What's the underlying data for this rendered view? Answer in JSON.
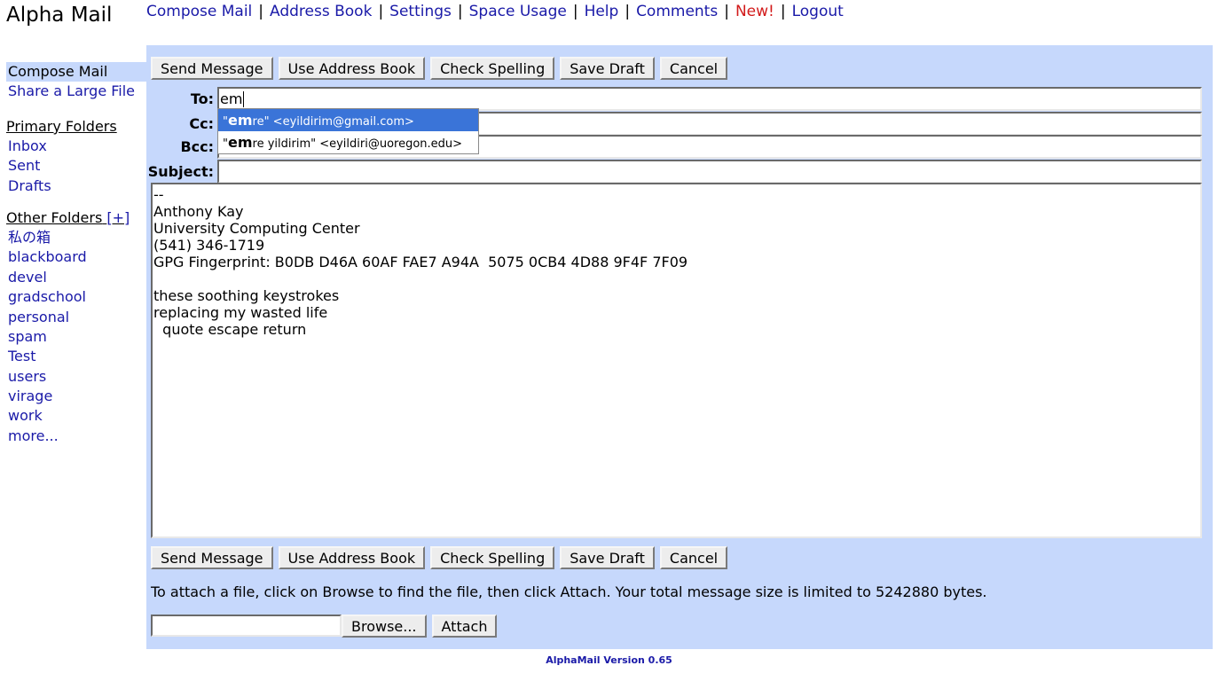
{
  "app_title": "Alpha Mail",
  "top_nav": [
    {
      "label": "Compose Mail"
    },
    {
      "label": "Address Book"
    },
    {
      "label": "Settings"
    },
    {
      "label": "Space Usage"
    },
    {
      "label": "Help"
    },
    {
      "label": "Comments"
    },
    {
      "label": "New!"
    },
    {
      "label": "Logout"
    }
  ],
  "top_nav_separator": "|",
  "sidebar": {
    "compose": "Compose Mail",
    "share": "Share a Large File",
    "primary_heading": "Primary Folders",
    "primary": [
      "Inbox",
      "Sent",
      "Drafts"
    ],
    "other_heading": "Other Folders",
    "other_add": "[+]",
    "other": [
      "私の箱",
      "blackboard",
      "devel",
      "gradschool",
      "personal",
      "spam",
      "Test",
      "users",
      "virage",
      "work",
      "more..."
    ]
  },
  "toolbar": {
    "send": "Send Message",
    "address_book": "Use Address Book",
    "spelling": "Check Spelling",
    "save_draft": "Save Draft",
    "cancel": "Cancel"
  },
  "fields": {
    "to_label": "To:",
    "to_value": "em",
    "cc_label": "Cc:",
    "bcc_label": "Bcc:",
    "subject_label": "Subject:"
  },
  "autocomplete": [
    {
      "quote_open": "\"",
      "match": "em",
      "rest": "re\" <eyildirim@gmail.com>"
    },
    {
      "quote_open": "\"",
      "match": "em",
      "rest": "re yildirim\" <eyildiri@uoregon.edu>"
    }
  ],
  "message_body": "--\nAnthony Kay\nUniversity Computing Center\n(541) 346-1719\nGPG Fingerprint: B0DB D46A 60AF FAE7 A94A  5075 0CB4 4D88 9F4F 7F09\n\nthese soothing keystrokes\nreplacing my wasted life\n  quote escape return",
  "attach_note": "To attach a file, click on Browse to find the file, then click Attach. Your total message size is limited to 5242880 bytes.",
  "browse_label": "Browse...",
  "attach_label": "Attach",
  "version": "AlphaMail Version 0.65",
  "colors": {
    "link": "#1a1aa8",
    "new": "#d21a1a",
    "panel": "#c6d8fc",
    "selected": "#3a74d8"
  }
}
